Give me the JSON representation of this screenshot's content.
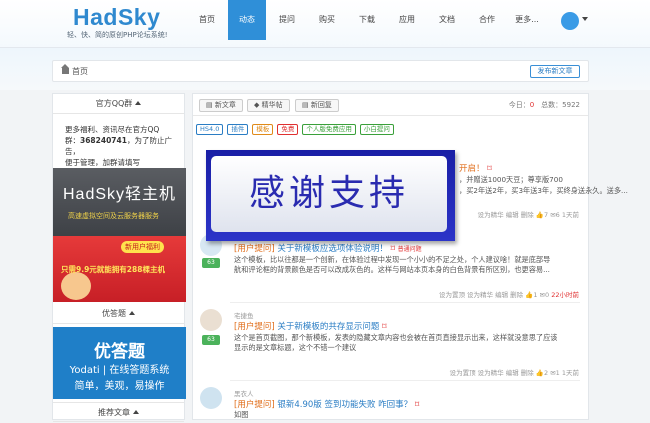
{
  "header": {
    "logo": "HadSky",
    "slogan": "轻、快、简的原创PHP论坛系统!",
    "nav": [
      "首页",
      "动态",
      "提问",
      "购买",
      "下载",
      "应用",
      "文档",
      "合作",
      "更多..."
    ],
    "active_nav": "动态"
  },
  "breadcrumb": {
    "home": "首页",
    "post_button": "发布新文章"
  },
  "sidebar": {
    "qq_title": "官方QQ群",
    "qq_text_1": "更多福利、资讯尽在官方QQ",
    "qq_text_2_prefix": "群：",
    "qq_number": "368240741",
    "qq_text_2_suffix": "，为了防止广告，",
    "qq_text_3": "便于管理，加群请填写hadsky.com",
    "ad1_title": "HadSky轻主机",
    "ad1_sub": "高速虚拟空间及云服务器服务",
    "ad2_badge": "新用户福利",
    "ad2_text": "只需9.9元就能拥有288棵主机",
    "youda_title": "优答题",
    "ad3_title": "优答题",
    "ad3_line1": "Yodati | 在线答题系统",
    "ad3_line2": "简单，美观，易操作",
    "recommend_title": "推荐文章"
  },
  "toolbar": {
    "new_article": "新文章",
    "featured": "精华帖",
    "new_reply": "新回复",
    "today_label": "今日：",
    "today_value": "0",
    "total_label": "总数：",
    "total_value": "5922"
  },
  "tags": [
    {
      "label": "HS4.0",
      "color": "#2a7dc4"
    },
    {
      "label": "插件",
      "color": "#2a7dc4"
    },
    {
      "label": "模板",
      "color": "#e08a18"
    },
    {
      "label": "免费",
      "color": "#e03030"
    },
    {
      "label": "个人版免费应用",
      "color": "#3aa03a"
    },
    {
      "label": "小白提问",
      "color": "#3aa03a"
    }
  ],
  "overlay_text": "感谢支持",
  "posts": [
    {
      "title_tail": "开启！",
      "body1": "，并赠送1000天豆；尊享版700",
      "body2": "，买2年送2年，买3年送3年，买终身送永久。送多...",
      "meta": "设为精华  编辑  删除",
      "likes": "7",
      "comments": "6",
      "time": "1天前"
    },
    {
      "count": "63",
      "category": "[用户提问]",
      "title": "关于新模板应选项体验说明！",
      "badge": "普通问题",
      "body1": "这个模板，比以往都是一个创新，在体验过程中发现一个小小的不足之处，个人建议啥！就是底部导",
      "body2": "航和评论框的背景颜色是否可以改成灰色的。这样与网站本页本身的白色背景有所区别，也更容易...",
      "meta": "设为置顶  设为精华  编辑  删除",
      "likes": "1",
      "comments": "0",
      "time": "22小时前"
    },
    {
      "author": "宅捷鱼",
      "count": "63",
      "category": "[用户提问]",
      "title": "关于新模板的共存显示问题",
      "body1": "这个是首页截图，那个新模板，发表的隐藏文章内容也会被在首页直接显示出来，这样就没意思了应该",
      "body2": "显示的是文章标题，这个不错一个建议",
      "meta": "设为置顶  设为精华  编辑  删除",
      "likes": "2",
      "comments": "1",
      "time": "1天前"
    },
    {
      "author": "黑衣人",
      "category": "[用户提问]",
      "title": "银新4.90版 签到功能失败 咋回事？",
      "body1": "如图"
    }
  ]
}
